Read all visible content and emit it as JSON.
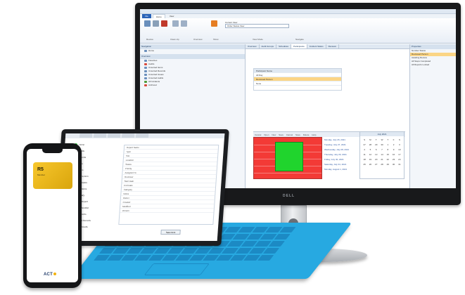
{
  "monitor": {
    "brand": "DELL",
    "ribbon_tabs": [
      "File",
      "Home",
      "View"
    ],
    "combo_label": "Current View",
    "combo_value": "Order Status View",
    "group_labels": [
      "Review",
      "Clean-Up",
      "Overview",
      "Show",
      "View Mode",
      "Navigate"
    ],
    "nav_header": "Navigation",
    "nav_items": [
      "Home",
      "Overview",
      "Favorites",
      "Audits",
      "Unsorted Items",
      "Unsorted Records",
      "Unsorted Issues",
      "Unsorted Audits",
      "All Incidents",
      "Archived"
    ],
    "doc_tabs": [
      "Overview",
      "Audit Groups",
      "Schedules",
      "Participants",
      "Incident Status",
      "Reviews"
    ],
    "grid_rows": [
      "Participant Name",
      "All Day",
      "Reviewed Person",
      "None"
    ],
    "schedule_bar": "Cancel Open New Save Cancel Save Delete Help",
    "dates": [
      "Monday, July 26, 2021",
      "Tuesday, July 27, 2021",
      "Wednesday, July 28, 2021",
      "Thursday, July 29, 2021",
      "Friday, July 30, 2021",
      "Saturday, July 31, 2021",
      "Monday, August 1, 2021"
    ],
    "calendar_title": "July 2021",
    "calendar_days": [
      "S",
      "M",
      "T",
      "W",
      "T",
      "F",
      "S",
      "27",
      "28",
      "29",
      "30",
      "1",
      "2",
      "3",
      "4",
      "5",
      "6",
      "7",
      "8",
      "9",
      "10",
      "11",
      "12",
      "13",
      "14",
      "15",
      "16",
      "17",
      "18",
      "19",
      "20",
      "21",
      "22",
      "23",
      "24",
      "25",
      "26",
      "27",
      "28",
      "29",
      "30",
      "31"
    ],
    "right_header": "Properties",
    "right_rows": [
      "Number Status",
      "Reviewed Person",
      "Awaiting Review",
      "All Steps Completed",
      "All Reports Locked"
    ]
  },
  "tablet": {
    "tree_items": [
      "Home",
      "Audits",
      "Records",
      "Items",
      "Issues",
      "Review Item",
      "Audit Dates",
      "Open Items",
      "Summary",
      "Status Report",
      "Audit Checklist",
      "Assignments",
      "Unsorted Records",
      "Review Results",
      "Reports",
      "Tools",
      "Help"
    ],
    "property_rows": [
      "Report Name",
      "Type",
      "Site",
      "Location",
      "Status",
      "Priority",
      "Assigned To",
      "Reviewer",
      "Start Date",
      "End Date",
      "Category",
      "Notes",
      "Owner",
      "Created",
      "Modified",
      "Version"
    ],
    "button_label": "Save Item"
  },
  "phone": {
    "card_amount": "R5",
    "card_sub": "Member",
    "logo_text": "ACT"
  },
  "colors": {
    "schedule_red": "#f33a36",
    "schedule_green": "#20d42d",
    "selection": "#fbd585",
    "keyboard_blue": "#27a9e1",
    "card_gold": "#f8c72d"
  }
}
